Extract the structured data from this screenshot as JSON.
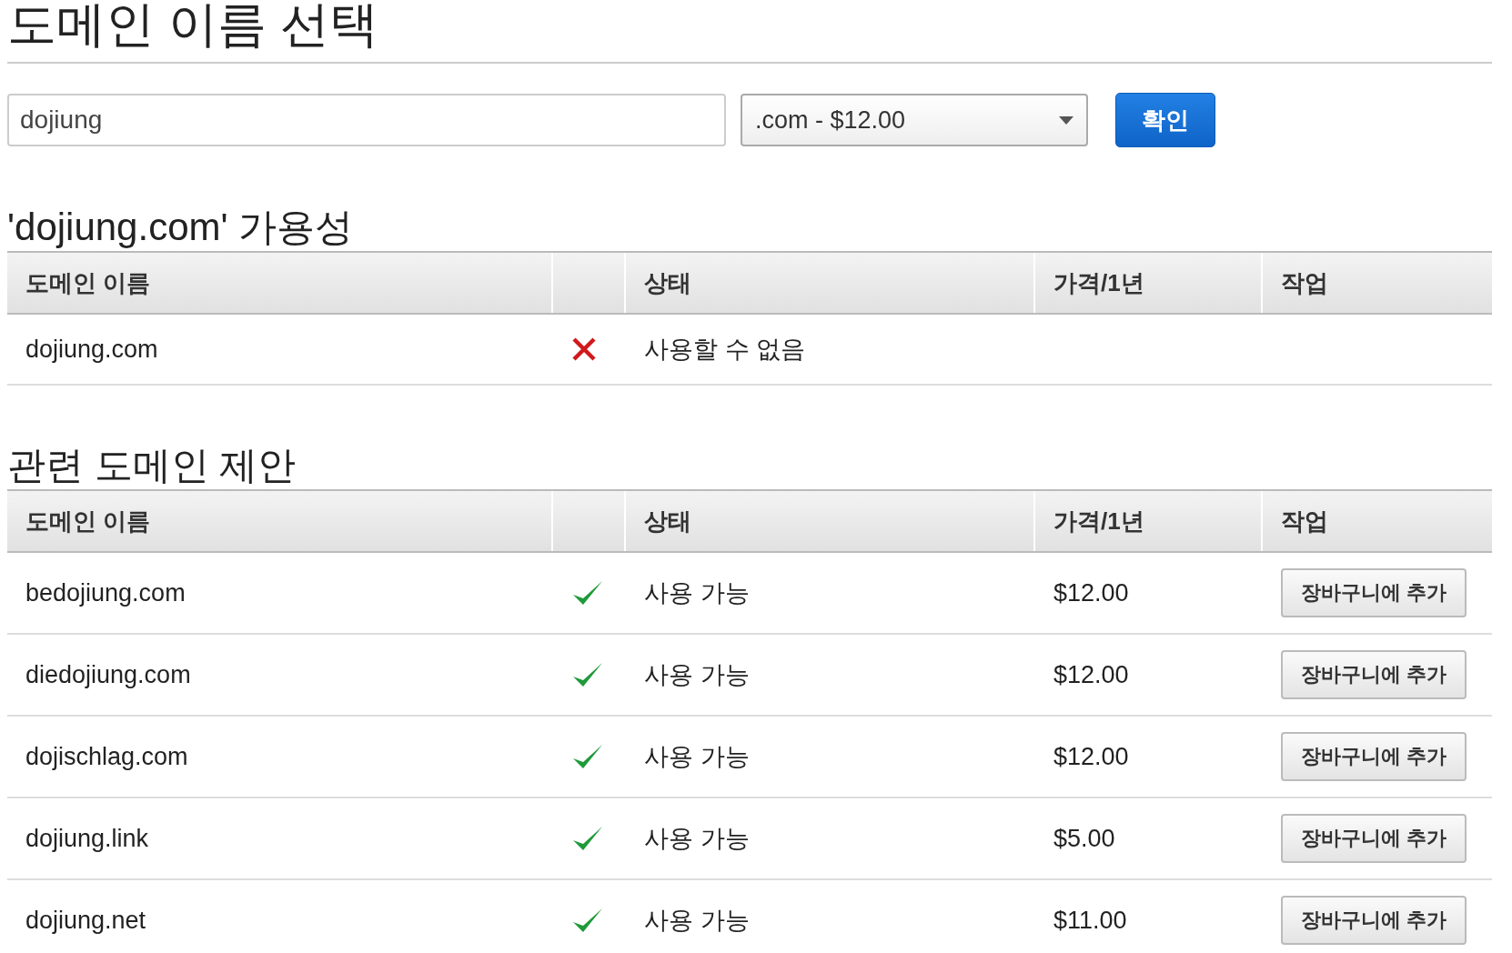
{
  "title": "도메인 이름 선택",
  "search": {
    "value": "dojiung",
    "tld": ".com - $12.00",
    "button": "확인"
  },
  "sections": [
    {
      "heading": "'dojiung.com' 가용성",
      "columns": [
        "도메인 이름",
        "상태",
        "가격/1년",
        "작업"
      ],
      "rows": [
        {
          "domain": "dojiung.com",
          "available": false,
          "status": "사용할 수 없음"
        }
      ]
    },
    {
      "heading": "관련 도메인 제안",
      "columns": [
        "도메인 이름",
        "상태",
        "가격/1년",
        "작업"
      ],
      "rows": [
        {
          "domain": "bedojiung.com",
          "available": true,
          "status": "사용 가능",
          "price": "$12.00",
          "action": "장바구니에 추가"
        },
        {
          "domain": "diedojiung.com",
          "available": true,
          "status": "사용 가능",
          "price": "$12.00",
          "action": "장바구니에 추가"
        },
        {
          "domain": "dojischlag.com",
          "available": true,
          "status": "사용 가능",
          "price": "$12.00",
          "action": "장바구니에 추가"
        },
        {
          "domain": "dojiung.link",
          "available": true,
          "status": "사용 가능",
          "price": "$5.00",
          "action": "장바구니에 추가"
        },
        {
          "domain": "dojiung.net",
          "available": true,
          "status": "사용 가능",
          "price": "$11.00",
          "action": "장바구니에 추가"
        }
      ]
    }
  ]
}
